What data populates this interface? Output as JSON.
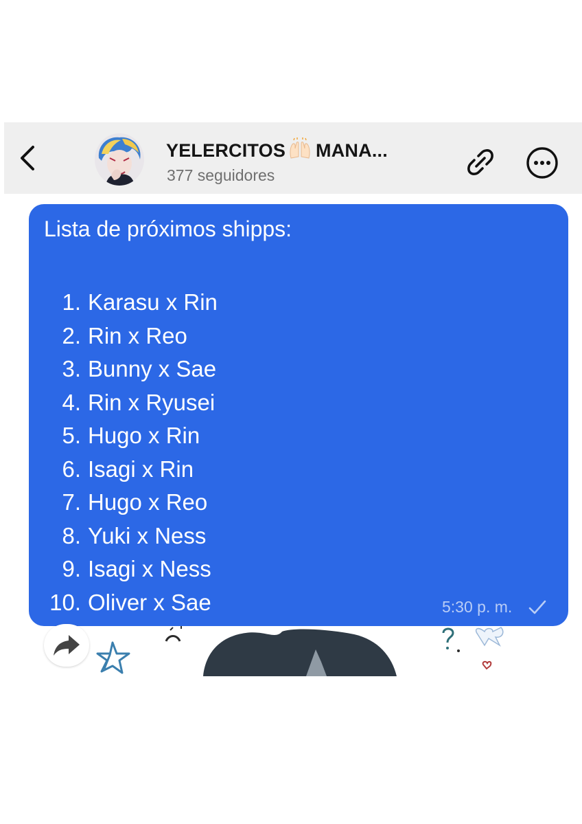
{
  "header": {
    "back_icon": "chevron-left-icon",
    "channel_name": "YELERCITOS",
    "channel_emoji": "raising-hands-emoji",
    "channel_name_suffix": "MANA...",
    "followers": "377 seguidores",
    "link_icon": "link-icon",
    "more_icon": "more-options-icon",
    "background_color": "#efefef"
  },
  "message": {
    "heading": "Lista de próximos shipps:",
    "items": [
      {
        "num": "1.",
        "text": "Karasu x Rin"
      },
      {
        "num": "2.",
        "text": "Rin x Reo"
      },
      {
        "num": "3.",
        "text": "Bunny x Sae"
      },
      {
        "num": "4.",
        "text": "Rin x Ryusei"
      },
      {
        "num": "5.",
        "text": "Hugo x Rin"
      },
      {
        "num": "6.",
        "text": "Isagi x Rin"
      },
      {
        "num": "7.",
        "text": "Hugo x Reo"
      },
      {
        "num": "8.",
        "text": "Yuki x Ness"
      },
      {
        "num": "9.",
        "text": "Isagi x Ness"
      },
      {
        "num": "10.",
        "text": "Oliver x Sae"
      }
    ],
    "time": "5:30 p. m.",
    "status_icon": "checkmark-icon",
    "bubble_color": "#2c68e6"
  },
  "actions": {
    "forward_icon": "forward-arrow-icon"
  }
}
